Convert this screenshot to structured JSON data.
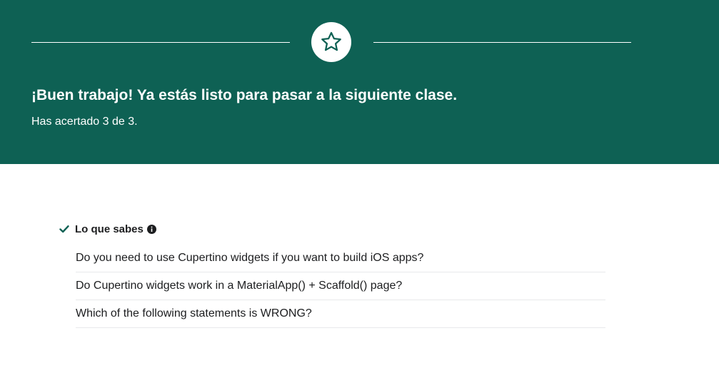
{
  "banner": {
    "icon": "star-icon",
    "headline": "¡Buen trabajo! Ya estás listo para pasar a la siguiente clase.",
    "score_text": "Has acertado 3 de 3.",
    "background_color": "#0e6154"
  },
  "results": {
    "status_icon": "check-icon",
    "title": "Lo que sabes",
    "info_icon": "info-icon",
    "questions": [
      {
        "text": "Do you need to use Cupertino widgets if you want to build iOS apps?"
      },
      {
        "text": "Do Cupertino widgets work in a MaterialApp() + Scaffold() page?"
      },
      {
        "text": "Which of the following statements is WRONG?"
      }
    ]
  }
}
